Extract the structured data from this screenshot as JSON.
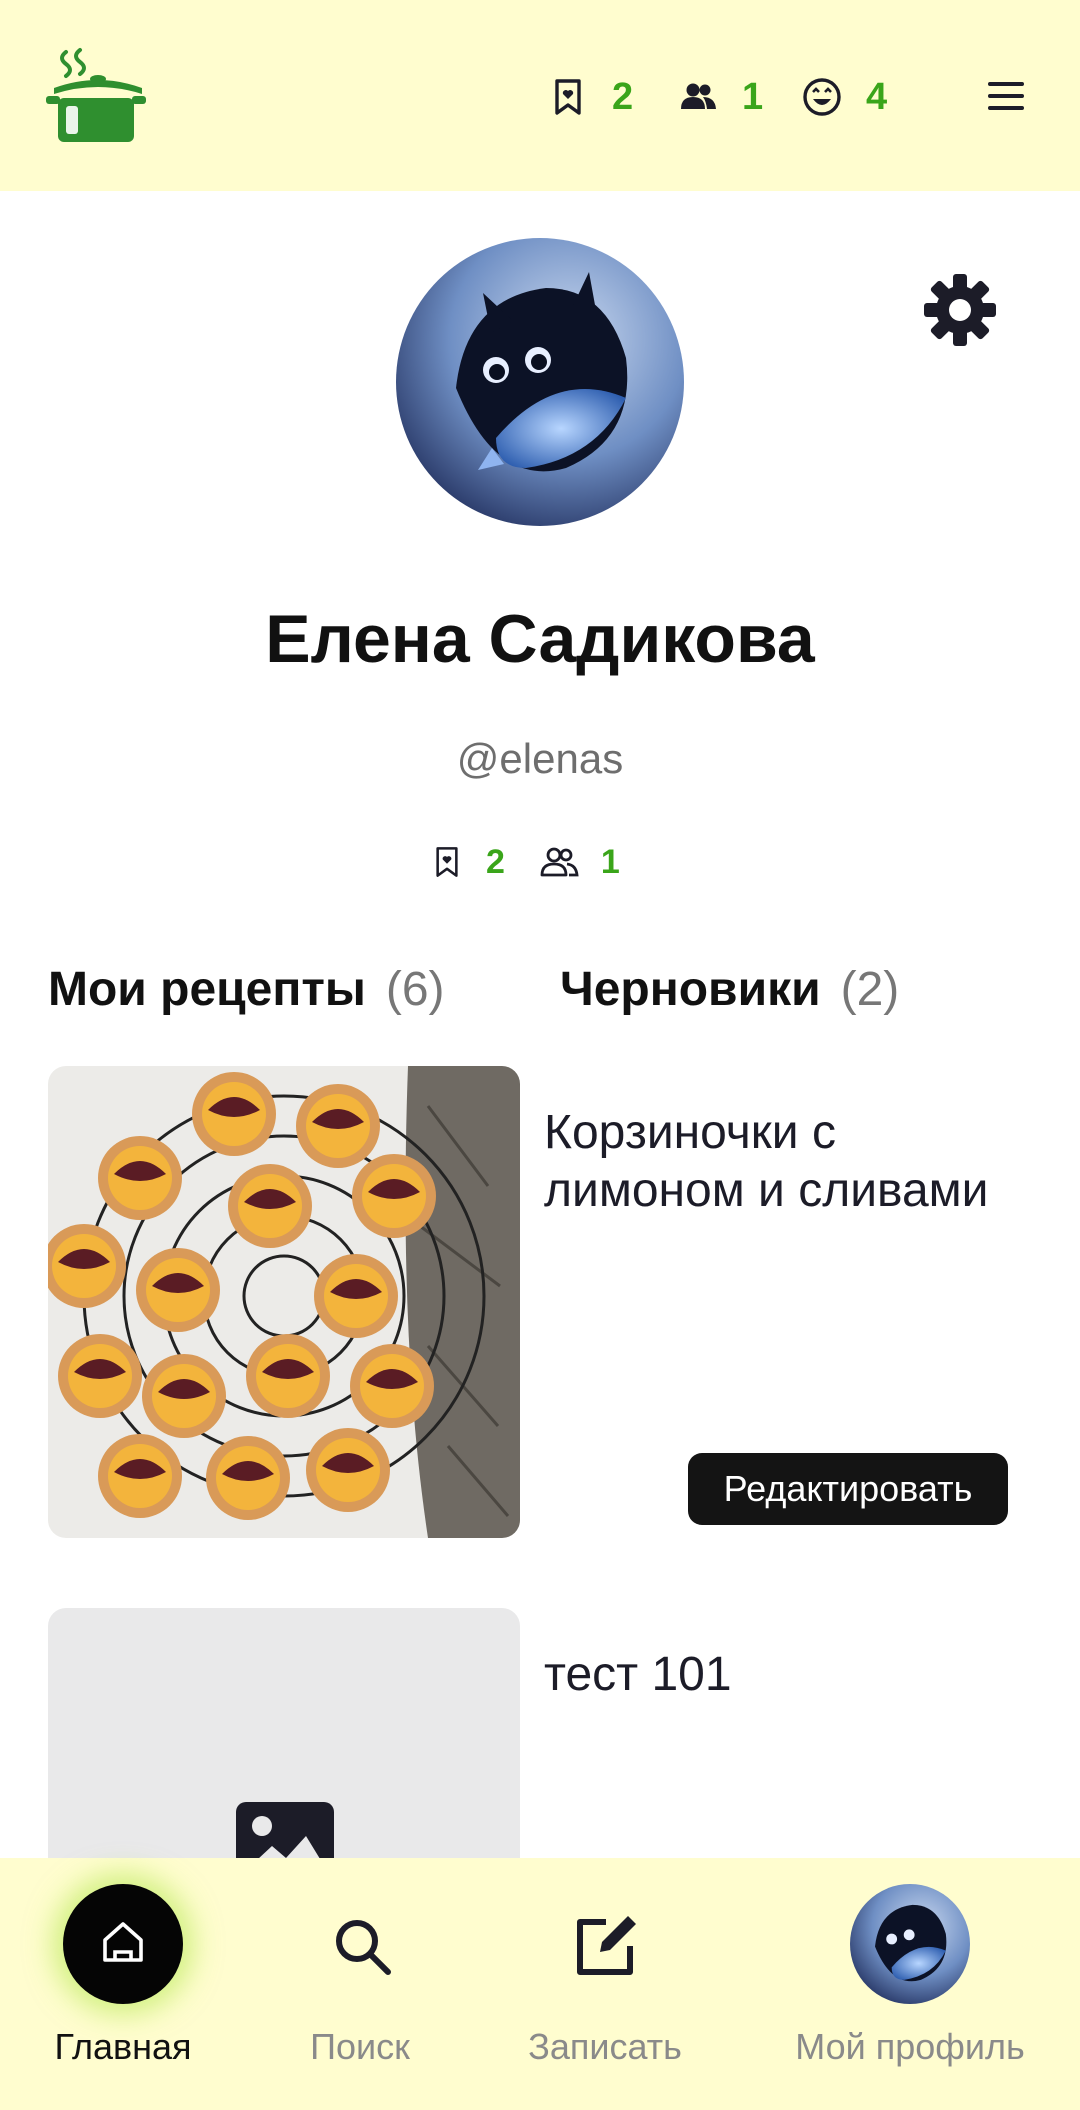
{
  "header": {
    "saved_count": "2",
    "subscribers_count": "1",
    "reactions_count": "4"
  },
  "profile": {
    "name": "Елена Садикова",
    "handle": "@elenas",
    "saved_count": "2",
    "subscribers_count": "1"
  },
  "tabs": [
    {
      "label": "Мои рецепты",
      "count": "(6)"
    },
    {
      "label": "Черновики",
      "count": "(2)"
    }
  ],
  "recipes": [
    {
      "title_line1": "Корзиночки с",
      "title_line2": "лимоном и сливами",
      "edit_label": "Редактировать"
    },
    {
      "title_line1": "тест 101"
    }
  ],
  "bottom_nav": [
    {
      "label": "Главная",
      "icon": "home-icon",
      "active": true
    },
    {
      "label": "Поиск",
      "icon": "search-icon"
    },
    {
      "label": "Записать",
      "icon": "edit-icon"
    },
    {
      "label": "Мой профиль",
      "icon": "avatar"
    }
  ],
  "colors": {
    "accent_green": "#3aa51a",
    "header_bg": "#fffdcf",
    "dark": "#1c1c28"
  }
}
